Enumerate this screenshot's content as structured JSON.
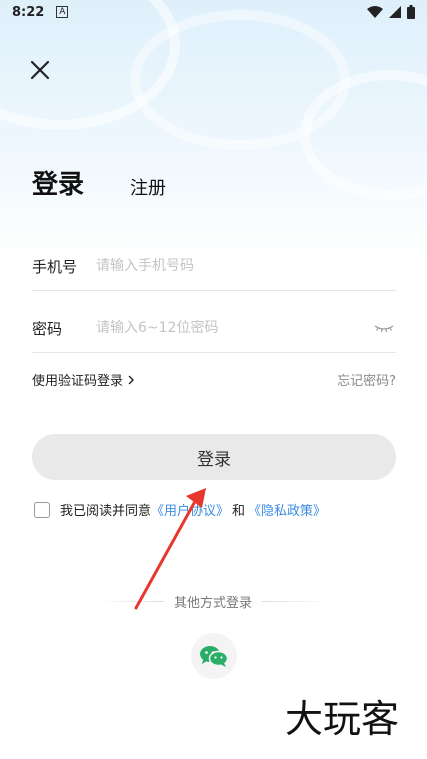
{
  "status_bar": {
    "time": "8:22",
    "app_icon": "A"
  },
  "icons": {
    "close": "close-icon",
    "eye": "eye-closed-icon",
    "wechat": "wechat-icon",
    "wifi": "wifi-icon",
    "signal": "signal-icon",
    "battery": "battery-icon"
  },
  "tabs": {
    "login": "登录",
    "register": "注册"
  },
  "form": {
    "phone_label": "手机号",
    "phone_placeholder": "请输入手机号码",
    "phone_value": "",
    "password_label": "密码",
    "password_placeholder": "请输入6~12位密码",
    "password_value": ""
  },
  "links": {
    "sms_login": "使用验证码登录",
    "forgot_password": "忘记密码?"
  },
  "login_button": "登录",
  "agreement": {
    "prefix": "我已阅读并同意",
    "user_agreement": "《用户协议》",
    "and": "和",
    "privacy_policy": "《隐私政策》",
    "checked": false
  },
  "other_login": {
    "label": "其他方式登录"
  },
  "watermark": "大玩客",
  "colors": {
    "link": "#3a8de0",
    "button_bg": "#e9e9e9",
    "annotation_arrow": "#e8372c",
    "wechat_green": "#2aae67"
  }
}
